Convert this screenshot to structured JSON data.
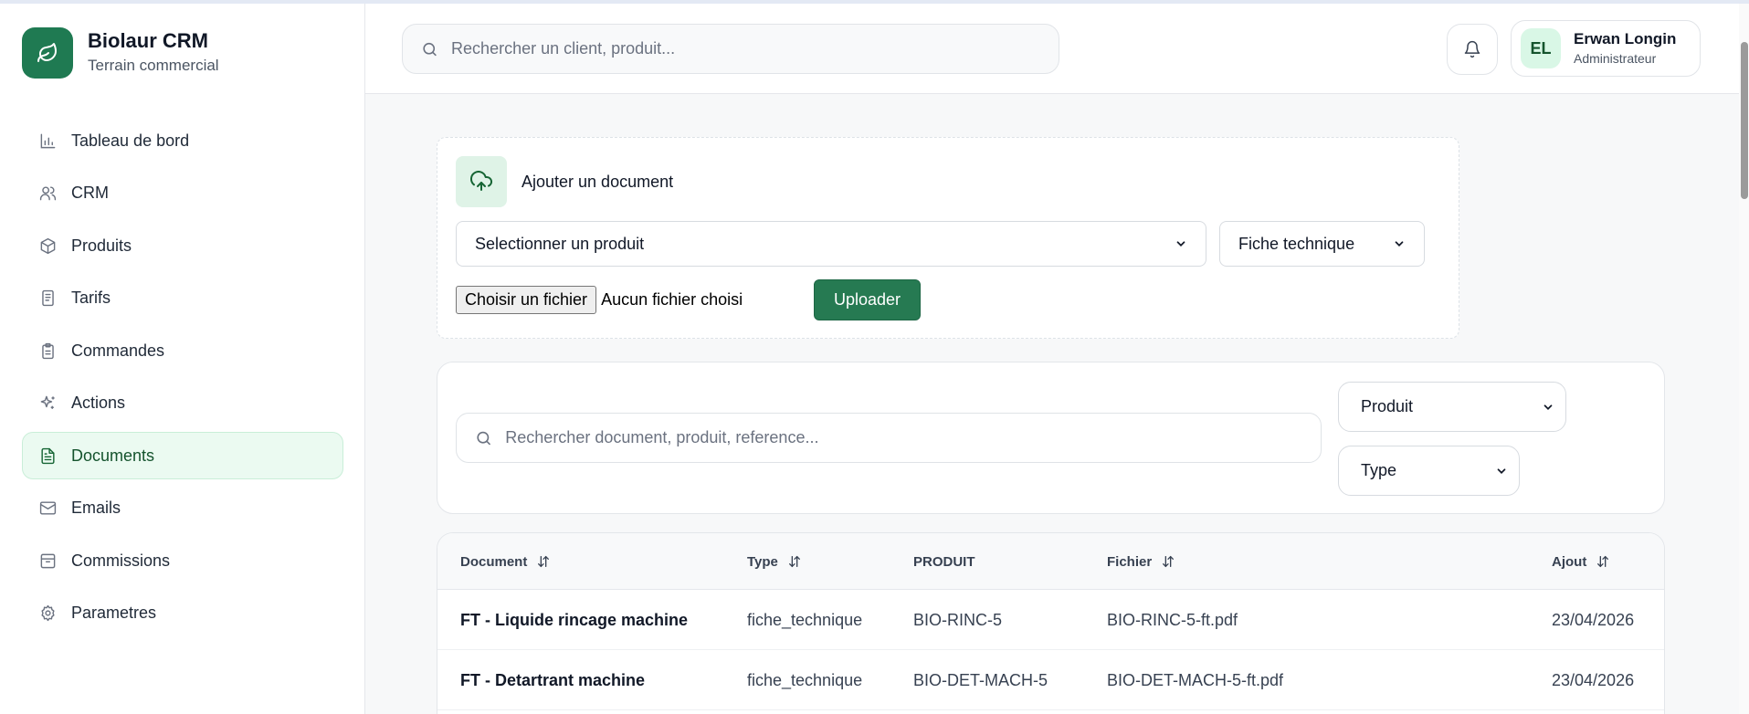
{
  "app": {
    "title": "Biolaur CRM",
    "subtitle": "Terrain commercial"
  },
  "sidebar": {
    "items": [
      {
        "label": "Tableau de bord",
        "icon": "bar-chart-icon"
      },
      {
        "label": "CRM",
        "icon": "users-icon"
      },
      {
        "label": "Produits",
        "icon": "box-icon"
      },
      {
        "label": "Tarifs",
        "icon": "file-list-icon"
      },
      {
        "label": "Commandes",
        "icon": "clipboard-icon"
      },
      {
        "label": "Actions",
        "icon": "sparkles-icon"
      },
      {
        "label": "Documents",
        "icon": "document-icon",
        "active": true
      },
      {
        "label": "Emails",
        "icon": "mail-icon"
      },
      {
        "label": "Commissions",
        "icon": "archive-icon"
      },
      {
        "label": "Parametres",
        "icon": "gear-icon"
      }
    ]
  },
  "topbar": {
    "search_placeholder": "Rechercher un client, produit...",
    "user": {
      "initials": "EL",
      "name": "Erwan Longin",
      "role": "Administrateur"
    }
  },
  "upload": {
    "title": "Ajouter un document",
    "product_select": "Selectionner un produit",
    "type_select": "Fiche technique",
    "file_button": "Choisir un fichier",
    "file_status": "Aucun fichier choisi",
    "submit": "Uploader"
  },
  "filters": {
    "search_placeholder": "Rechercher document, produit, reference...",
    "product_select": "Produit",
    "type_select": "Type"
  },
  "table": {
    "columns": [
      "Document",
      "Type",
      "PRODUIT",
      "Fichier",
      "Ajout"
    ],
    "rows": [
      {
        "document": "FT - Liquide rincage machine",
        "type": "fiche_technique",
        "produit": "BIO-RINC-5",
        "fichier": "BIO-RINC-5-ft.pdf",
        "ajout": "23/04/2026"
      },
      {
        "document": "FT - Detartrant machine",
        "type": "fiche_technique",
        "produit": "BIO-DET-MACH-5",
        "fichier": "BIO-DET-MACH-5-ft.pdf",
        "ajout": "23/04/2026"
      }
    ]
  },
  "colors": {
    "brand": "#1f7a52",
    "active_bg": "#ebfaf1",
    "button": "#267a52"
  }
}
